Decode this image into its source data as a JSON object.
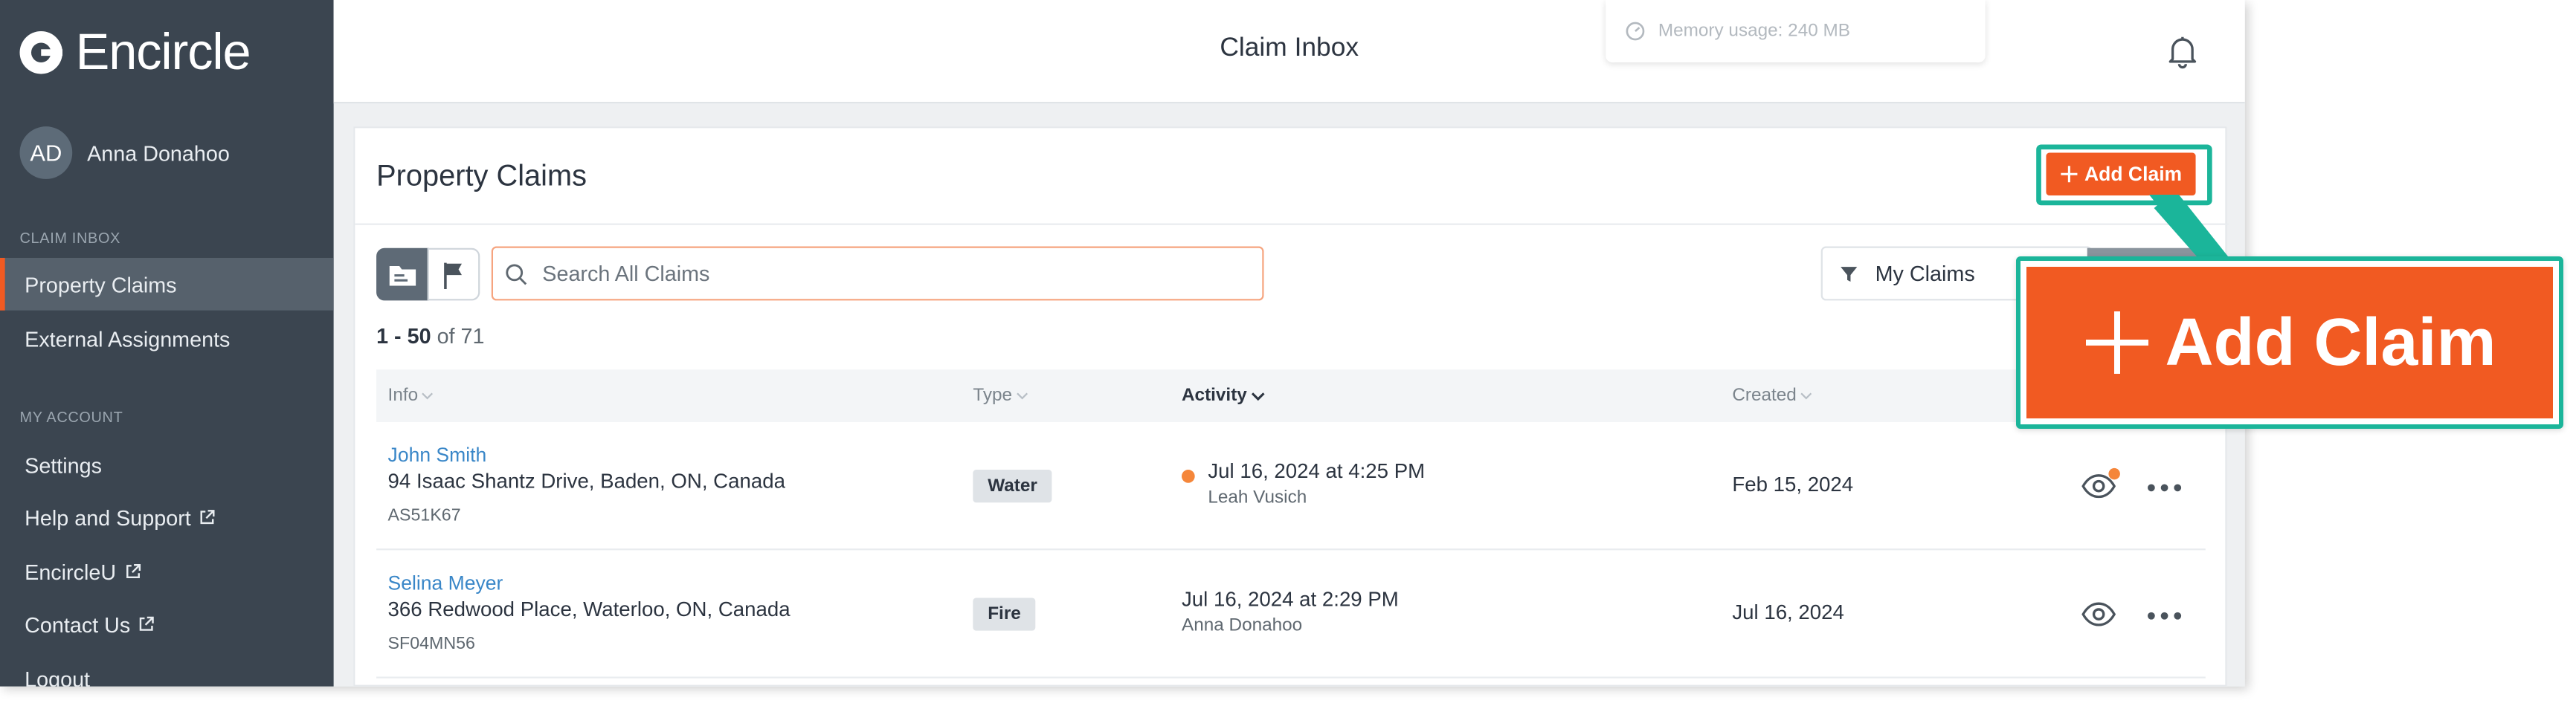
{
  "app": {
    "logo_text": "Encircle",
    "user": {
      "initials": "AD",
      "name": "Anna Donahoo"
    }
  },
  "sidebar": {
    "section_claim_inbox": "CLAIM INBOX",
    "section_my_account": "MY ACCOUNT",
    "items": [
      {
        "label": "Property Claims",
        "active": true
      },
      {
        "label": "External Assignments",
        "active": false
      },
      {
        "label": "Settings",
        "active": false
      },
      {
        "label": "Help and Support",
        "active": false,
        "external": true
      },
      {
        "label": "EncircleU",
        "active": false,
        "external": true
      },
      {
        "label": "Contact Us",
        "active": false,
        "external": true
      },
      {
        "label": "Logout",
        "active": false
      }
    ]
  },
  "header": {
    "title": "Claim Inbox",
    "memory_usage": "Memory usage: 240 MB"
  },
  "main": {
    "title": "Property Claims",
    "add_claim_label": "Add Claim",
    "search_placeholder": "Search All Claims",
    "filter_label": "My Claims",
    "count_range": "1 - 50",
    "count_total": "of 71",
    "columns": {
      "info": "Info",
      "type": "Type",
      "activity": "Activity",
      "created": "Created"
    },
    "rows": [
      {
        "name": "John Smith",
        "address": "94 Isaac Shantz Drive, Baden, ON, Canada",
        "code": "AS51K67",
        "type": "Water",
        "activity_time": "Jul 16, 2024 at 4:25 PM",
        "activity_user": "Leah Vusich",
        "unread": true,
        "created": "Feb 15, 2024"
      },
      {
        "name": "Selina Meyer",
        "address": "366 Redwood Place, Waterloo, ON, Canada",
        "code": "SF04MN56",
        "type": "Fire",
        "activity_time": "Jul 16, 2024 at 2:29 PM",
        "activity_user": "Anna Donahoo",
        "unread": false,
        "created": "Jul 16, 2024"
      }
    ]
  },
  "zoom_callout": {
    "label": "Add Claim"
  },
  "colors": {
    "sidebar_bg": "#3b4550",
    "accent_orange": "#f15a22",
    "callout_teal": "#1bb59a",
    "link_blue": "#3a87c8"
  }
}
